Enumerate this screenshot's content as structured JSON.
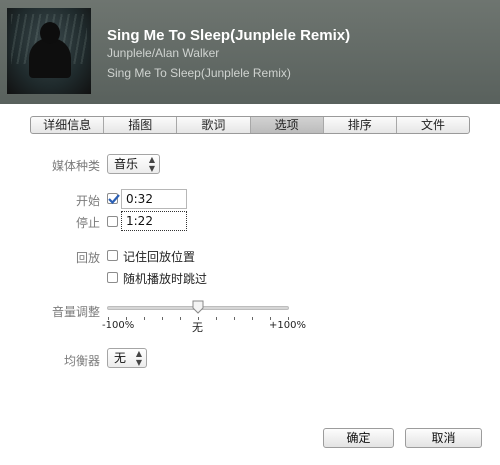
{
  "header": {
    "title": "Sing Me To Sleep(Junplele Remix)",
    "artist": "Junplele/Alan Walker",
    "album": "Sing Me To Sleep(Junplele Remix)",
    "artwork_icon": "album-artwork"
  },
  "tabs": [
    {
      "label": "详细信息",
      "active": false
    },
    {
      "label": "插图",
      "active": false
    },
    {
      "label": "歌词",
      "active": false
    },
    {
      "label": "选项",
      "active": true
    },
    {
      "label": "排序",
      "active": false
    },
    {
      "label": "文件",
      "active": false
    }
  ],
  "options": {
    "media_kind": {
      "label": "媒体种类",
      "value": "音乐"
    },
    "start": {
      "label": "开始",
      "checked": true,
      "value": "0:32"
    },
    "stop": {
      "label": "停止",
      "checked": false,
      "value": "1:22"
    },
    "playback": {
      "label": "回放",
      "remember_position": {
        "label": "记住回放位置",
        "checked": false
      },
      "skip_shuffle": {
        "label": "随机播放时跳过",
        "checked": false
      }
    },
    "volume": {
      "label": "音量调整",
      "min_label": "-100%",
      "mid_label": "无",
      "max_label": "+100%",
      "level_percent": 0
    },
    "equalizer": {
      "label": "均衡器",
      "value": "无"
    }
  },
  "buttons": {
    "ok": "确定",
    "cancel": "取消"
  },
  "colors": {
    "header_bg": "#626a66",
    "active_tab": "#c6c6c6",
    "check_blue": "#2a5fb5"
  }
}
